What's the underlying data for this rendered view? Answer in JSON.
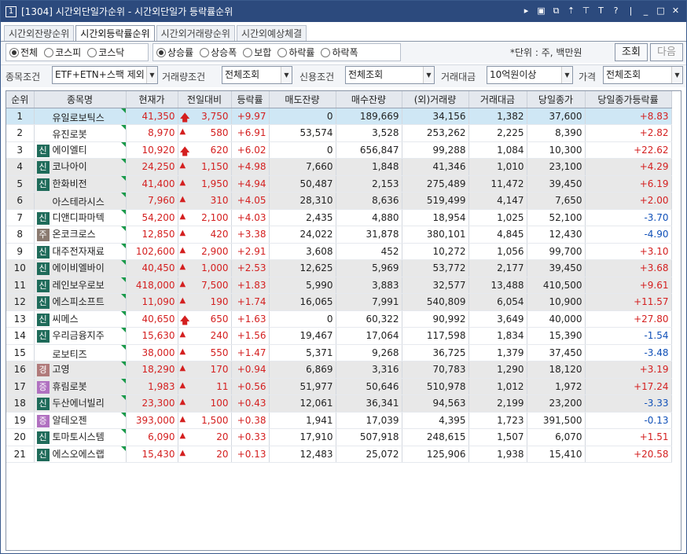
{
  "window": {
    "number": "1",
    "title": "[1304] 시간외단일가순위 - 시간외단일가 등락률순위",
    "icons": [
      "arrow-right-icon",
      "screen-icon",
      "window-icon",
      "pin-icon",
      "pushpin-icon",
      "text-icon",
      "help-icon",
      "minimize-icon",
      "maximize-icon",
      "close-icon"
    ]
  },
  "tabs": [
    "시간외잔량순위",
    "시간외등락률순위",
    "시간외거래량순위",
    "시간외예상체결"
  ],
  "active_tab": 1,
  "market_radios": [
    {
      "label": "전체",
      "selected": true
    },
    {
      "label": "코스피",
      "selected": false
    },
    {
      "label": "코스닥",
      "selected": false
    }
  ],
  "type_radios": [
    {
      "label": "상승률",
      "selected": true
    },
    {
      "label": "상승폭",
      "selected": false
    },
    {
      "label": "보합",
      "selected": false
    },
    {
      "label": "하락률",
      "selected": false
    },
    {
      "label": "하락폭",
      "selected": false
    }
  ],
  "unit_text": "*단위 : 주, 백만원",
  "buttons": {
    "search": "조회",
    "next": "다음"
  },
  "filters": {
    "stock_cond_label": "종목조건",
    "stock_cond": "ETF+ETN+스팩 제외",
    "volume_cond_label": "거래량조건",
    "volume_cond": "전체조회",
    "credit_cond_label": "신용조건",
    "credit_cond": "전체조회",
    "amount_label": "거래대금",
    "amount": "10억원이상",
    "price_label": "가격",
    "price": "전체조회"
  },
  "table": {
    "headers": [
      "순위",
      "종목명",
      "현재가",
      "전일대비",
      "등락률",
      "매도잔량",
      "매수잔량",
      "(외)거래량",
      "거래대금",
      "당일종가",
      "당일종가등락률"
    ],
    "rows": [
      {
        "rank": "1",
        "badge": "",
        "name": "유일로보틱스",
        "price": "41,350",
        "sign": "upper",
        "change": "3,750",
        "rate": "+9.97",
        "ask": "0",
        "bid": "189,669",
        "vol": "34,156",
        "amt": "1,382",
        "close": "37,600",
        "crate": "+8.83"
      },
      {
        "rank": "2",
        "badge": "",
        "name": "유진로봇",
        "price": "8,970",
        "sign": "up",
        "change": "580",
        "rate": "+6.91",
        "ask": "53,574",
        "bid": "3,528",
        "vol": "253,262",
        "amt": "2,225",
        "close": "8,390",
        "crate": "+2.82"
      },
      {
        "rank": "3",
        "badge": "신",
        "name": "에이엘티",
        "price": "10,920",
        "sign": "upper",
        "change": "620",
        "rate": "+6.02",
        "ask": "0",
        "bid": "656,847",
        "vol": "99,288",
        "amt": "1,084",
        "close": "10,300",
        "crate": "+22.62"
      },
      {
        "rank": "4",
        "badge": "신",
        "name": "코나아이",
        "price": "24,250",
        "sign": "up",
        "change": "1,150",
        "rate": "+4.98",
        "ask": "7,660",
        "bid": "1,848",
        "vol": "41,346",
        "amt": "1,010",
        "close": "23,100",
        "crate": "+4.29"
      },
      {
        "rank": "5",
        "badge": "신",
        "name": "한화비전",
        "price": "41,400",
        "sign": "up",
        "change": "1,950",
        "rate": "+4.94",
        "ask": "50,487",
        "bid": "2,153",
        "vol": "275,489",
        "amt": "11,472",
        "close": "39,450",
        "crate": "+6.19"
      },
      {
        "rank": "6",
        "badge": "",
        "name": "아스테라시스",
        "price": "7,960",
        "sign": "up",
        "change": "310",
        "rate": "+4.05",
        "ask": "28,310",
        "bid": "8,636",
        "vol": "519,499",
        "amt": "4,147",
        "close": "7,650",
        "crate": "+2.00"
      },
      {
        "rank": "7",
        "badge": "신",
        "name": "디앤디파마텍",
        "price": "54,200",
        "sign": "up",
        "change": "2,100",
        "rate": "+4.03",
        "ask": "2,435",
        "bid": "4,880",
        "vol": "18,954",
        "amt": "1,025",
        "close": "52,100",
        "crate": "-3.70"
      },
      {
        "rank": "8",
        "badge": "주",
        "name": "온코크로스",
        "price": "12,850",
        "sign": "up",
        "change": "420",
        "rate": "+3.38",
        "ask": "24,022",
        "bid": "31,878",
        "vol": "380,101",
        "amt": "4,845",
        "close": "12,430",
        "crate": "-4.90"
      },
      {
        "rank": "9",
        "badge": "신",
        "name": "대주전자재료",
        "price": "102,600",
        "sign": "up",
        "change": "2,900",
        "rate": "+2.91",
        "ask": "3,608",
        "bid": "452",
        "vol": "10,272",
        "amt": "1,056",
        "close": "99,700",
        "crate": "+3.10"
      },
      {
        "rank": "10",
        "badge": "신",
        "name": "에이비엘바이",
        "price": "40,450",
        "sign": "up",
        "change": "1,000",
        "rate": "+2.53",
        "ask": "12,625",
        "bid": "5,969",
        "vol": "53,772",
        "amt": "2,177",
        "close": "39,450",
        "crate": "+3.68"
      },
      {
        "rank": "11",
        "badge": "신",
        "name": "레인보우로보",
        "price": "418,000",
        "sign": "up",
        "change": "7,500",
        "rate": "+1.83",
        "ask": "5,990",
        "bid": "3,883",
        "vol": "32,577",
        "amt": "13,488",
        "close": "410,500",
        "crate": "+9.61"
      },
      {
        "rank": "12",
        "badge": "신",
        "name": "에스피소프트",
        "price": "11,090",
        "sign": "up",
        "change": "190",
        "rate": "+1.74",
        "ask": "16,065",
        "bid": "7,991",
        "vol": "540,809",
        "amt": "6,054",
        "close": "10,900",
        "crate": "+11.57"
      },
      {
        "rank": "13",
        "badge": "신",
        "name": "씨메스",
        "price": "40,650",
        "sign": "upper",
        "change": "650",
        "rate": "+1.63",
        "ask": "0",
        "bid": "60,322",
        "vol": "90,992",
        "amt": "3,649",
        "close": "40,000",
        "crate": "+27.80"
      },
      {
        "rank": "14",
        "badge": "신",
        "name": "우리금융지주",
        "price": "15,630",
        "sign": "up",
        "change": "240",
        "rate": "+1.56",
        "ask": "19,467",
        "bid": "17,064",
        "vol": "117,598",
        "amt": "1,834",
        "close": "15,390",
        "crate": "-1.54"
      },
      {
        "rank": "15",
        "badge": "",
        "name": "로보티즈",
        "price": "38,000",
        "sign": "up",
        "change": "550",
        "rate": "+1.47",
        "ask": "5,371",
        "bid": "9,268",
        "vol": "36,725",
        "amt": "1,379",
        "close": "37,450",
        "crate": "-3.48"
      },
      {
        "rank": "16",
        "badge": "경",
        "name": "고영",
        "price": "18,290",
        "sign": "up",
        "change": "170",
        "rate": "+0.94",
        "ask": "6,869",
        "bid": "3,316",
        "vol": "70,783",
        "amt": "1,290",
        "close": "18,120",
        "crate": "+3.19"
      },
      {
        "rank": "17",
        "badge": "증",
        "name": "휴림로봇",
        "price": "1,983",
        "sign": "up",
        "change": "11",
        "rate": "+0.56",
        "ask": "51,977",
        "bid": "50,646",
        "vol": "510,978",
        "amt": "1,012",
        "close": "1,972",
        "crate": "+17.24"
      },
      {
        "rank": "18",
        "badge": "신",
        "name": "두산에너빌리",
        "price": "23,300",
        "sign": "up",
        "change": "100",
        "rate": "+0.43",
        "ask": "12,061",
        "bid": "36,341",
        "vol": "94,563",
        "amt": "2,199",
        "close": "23,200",
        "crate": "-3.33"
      },
      {
        "rank": "19",
        "badge": "증",
        "name": "알테오젠",
        "price": "393,000",
        "sign": "up",
        "change": "1,500",
        "rate": "+0.38",
        "ask": "1,941",
        "bid": "17,039",
        "vol": "4,395",
        "amt": "1,723",
        "close": "391,500",
        "crate": "-0.13"
      },
      {
        "rank": "20",
        "badge": "신",
        "name": "토마토시스템",
        "price": "6,090",
        "sign": "up",
        "change": "20",
        "rate": "+0.33",
        "ask": "17,910",
        "bid": "507,918",
        "vol": "248,615",
        "amt": "1,507",
        "close": "6,070",
        "crate": "+1.51"
      },
      {
        "rank": "21",
        "badge": "신",
        "name": "에스오에스랩",
        "price": "15,430",
        "sign": "up",
        "change": "20",
        "rate": "+0.13",
        "ask": "12,483",
        "bid": "25,072",
        "vol": "125,906",
        "amt": "1,938",
        "close": "15,410",
        "crate": "+20.58"
      }
    ]
  },
  "colors": {
    "up": "#d42020",
    "down": "#1050b8",
    "badge_shin": "#1f6b5a",
    "badge_ju": "#8a7a70",
    "badge_gyeong": "#b07a7a",
    "badge_jeung": "#b070c0",
    "title_bar": "#2c4a7d"
  }
}
